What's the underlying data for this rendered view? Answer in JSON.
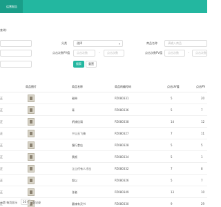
{
  "header": {
    "active_tab": "运营报告"
  },
  "filters": {
    "section_title": "查询)",
    "row1": {
      "mid_label": "分类",
      "mid_select_value": "选择",
      "right_label": "商品名称",
      "right_placeholder": "请输入商品"
    },
    "row2": {
      "mid_label": "点击次数PV值",
      "mid_from_placeholder": "点击次数",
      "mid_to_placeholder": "点击次数",
      "right_label": "点击次数PV值",
      "right_from_placeholder": "点击次数",
      "right_to_placeholder": "点击次数"
    },
    "buttons": {
      "search": "搜索",
      "reset": "重置"
    }
  },
  "table": {
    "headers": {
      "c0": "",
      "c1": "商品图片",
      "c2": "商品名称",
      "c3": "商品的编号码",
      "c4": "点击UV值",
      "c5": "点击PV"
    },
    "rows": [
      {
        "c0": "正",
        "name": "磁带",
        "code": "PZ080331",
        "uv": "5",
        "pv": "20"
      },
      {
        "c0": "正",
        "name": "青",
        "code": "PZ080336",
        "uv": "5",
        "pv": "7"
      },
      {
        "c0": "正",
        "name": "帆铺信请",
        "code": "PZ080338",
        "uv": "14",
        "pv": "12"
      },
      {
        "c0": "正",
        "name": "宁山玉飞骑",
        "code": "PZ080327",
        "uv": "7",
        "pv": "11"
      },
      {
        "c0": "正",
        "name": "慢行食店",
        "code": "PZ080328",
        "uv": "5",
        "pv": "5"
      },
      {
        "c0": "正",
        "name": "素颜",
        "code": "PZ080334",
        "uv": "5",
        "pv": "1"
      },
      {
        "c0": "正",
        "name": "江山代有人才出",
        "code": "PZ080332",
        "uv": "7",
        "pv": "8"
      },
      {
        "c0": "正",
        "name": "叙以",
        "code": "PZ080326",
        "uv": "5",
        "pv": "7"
      },
      {
        "c0": "正",
        "name": "张者",
        "code": "PZ080349",
        "uv": "13",
        "pv": "10"
      },
      {
        "c0": "正",
        "name": "圆魂有灵书",
        "code": "PZ080330",
        "uv": "9",
        "pv": "29"
      }
    ]
  },
  "footer": {
    "left_text": "示第 每页显示",
    "page_size": "10",
    "page_size_caret": "▾",
    "right_text": "条记录"
  }
}
